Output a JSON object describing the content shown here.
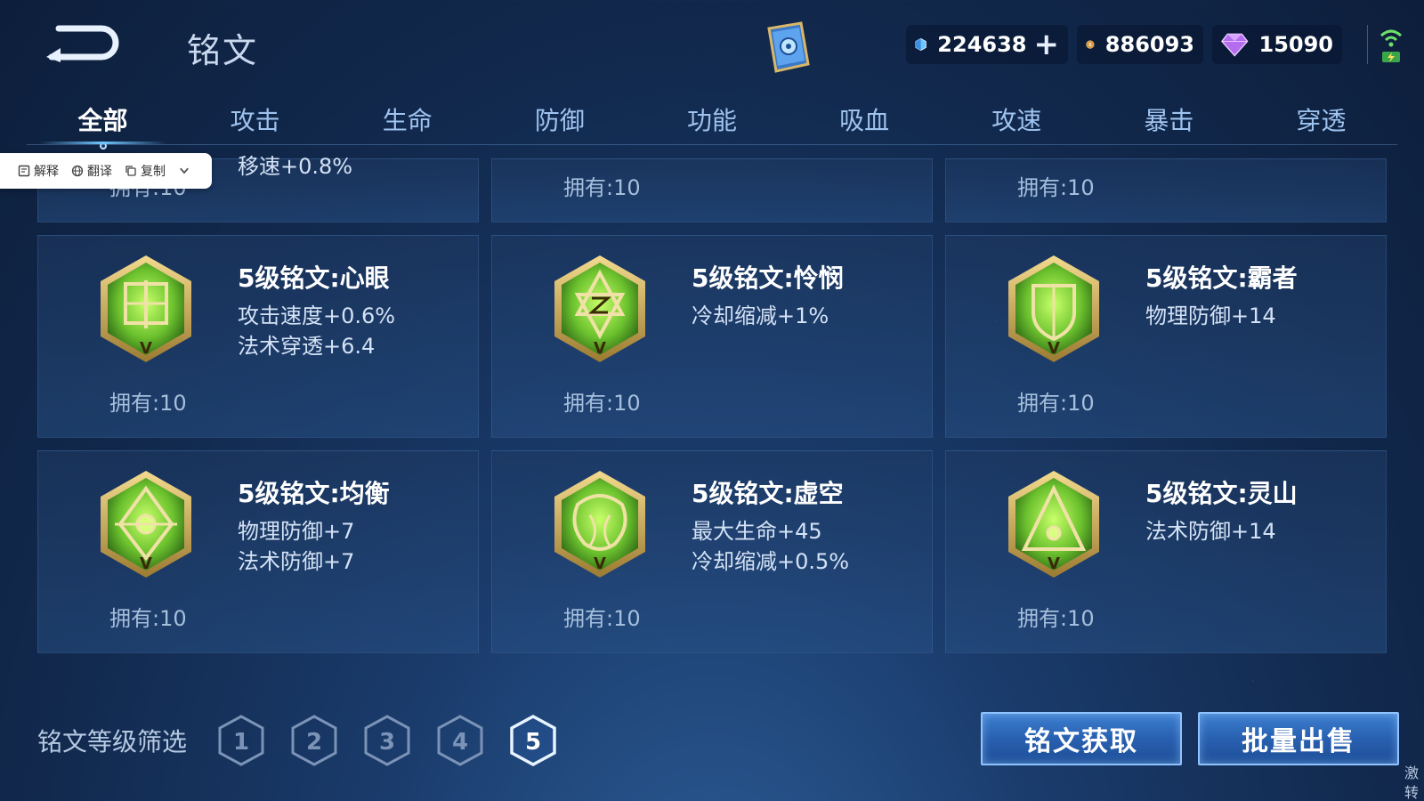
{
  "header": {
    "title": "铭文",
    "currencies": {
      "gem": "224638",
      "gold": "886093",
      "diamond": "15090"
    },
    "plus": "+"
  },
  "tabs": [
    "全部",
    "攻击",
    "生命",
    "防御",
    "功能",
    "吸血",
    "攻速",
    "暴击",
    "穿透"
  ],
  "popup": {
    "explain": "解释",
    "translate": "翻译",
    "copy": "复制"
  },
  "partial_row": {
    "left_text": "移速+0.8%",
    "owned": [
      "拥有:10",
      "拥有:10",
      "拥有:10"
    ]
  },
  "cards": [
    {
      "name": "5级铭文:心眼",
      "attrs": [
        "攻击速度+0.6%",
        "法术穿透+6.4"
      ],
      "owned": "拥有:10"
    },
    {
      "name": "5级铭文:怜悯",
      "attrs": [
        "冷却缩减+1%",
        ""
      ],
      "owned": "拥有:10"
    },
    {
      "name": "5级铭文:霸者",
      "attrs": [
        "物理防御+14",
        ""
      ],
      "owned": "拥有:10"
    },
    {
      "name": "5级铭文:均衡",
      "attrs": [
        "物理防御+7",
        "法术防御+7"
      ],
      "owned": "拥有:10"
    },
    {
      "name": "5级铭文:虚空",
      "attrs": [
        "最大生命+45",
        "冷却缩减+0.5%"
      ],
      "owned": "拥有:10"
    },
    {
      "name": "5级铭文:灵山",
      "attrs": [
        "法术防御+14",
        ""
      ],
      "owned": "拥有:10"
    }
  ],
  "filter": {
    "label": "铭文等级筛选",
    "levels": [
      "1",
      "2",
      "3",
      "4",
      "5"
    ],
    "selected": "5"
  },
  "buttons": {
    "get": "铭文获取",
    "sell": "批量出售"
  },
  "corner_text": "激转",
  "colors": {
    "accent": "#6fc6ff",
    "emblem_green": "#7ed63a",
    "emblem_gold": "#d8b45a"
  }
}
